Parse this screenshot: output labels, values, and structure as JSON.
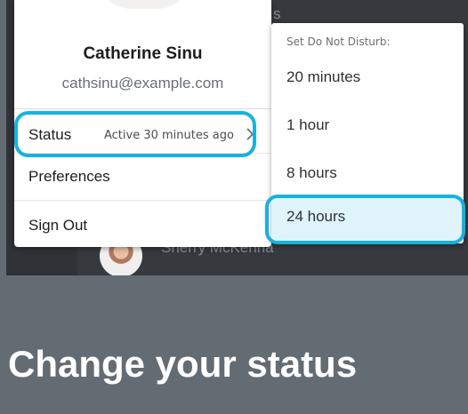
{
  "background": {
    "top_text": "s",
    "contact_name": "Sherry McKenna"
  },
  "account_menu": {
    "user_name": "Catherine Sinu",
    "user_email": "cathsinu@example.com",
    "status_label": "Status",
    "status_detail": "Active 30 minutes ago",
    "preferences_label": "Preferences",
    "sign_out_label": "Sign Out"
  },
  "dnd_submenu": {
    "header": "Set Do Not Disturb:",
    "options": [
      {
        "label": "20 minutes"
      },
      {
        "label": "1 hour"
      },
      {
        "label": "8 hours"
      },
      {
        "label": "24 hours"
      }
    ],
    "highlighted_option": "24 hours"
  },
  "caption": "Change your status",
  "colors": {
    "highlight": "#17b1e0",
    "page_background": "#636b73",
    "app_background": "#36393e"
  }
}
